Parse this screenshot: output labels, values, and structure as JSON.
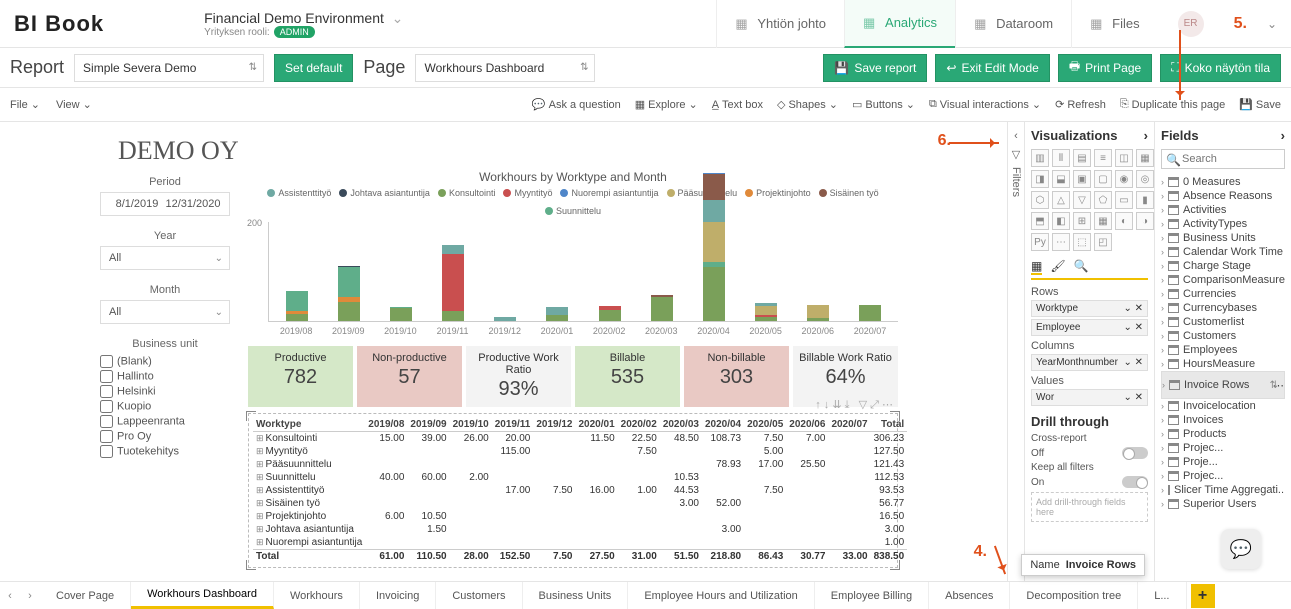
{
  "logo": "BI Book",
  "env": {
    "title": "Financial Demo Environment",
    "sub": "Yrityksen rooli:",
    "badge": "ADMIN"
  },
  "topnav": [
    {
      "label": "Yhtiön johto"
    },
    {
      "label": "Analytics",
      "active": true
    },
    {
      "label": "Dataroom"
    },
    {
      "label": "Files"
    }
  ],
  "user": "ER",
  "annot": {
    "n4": "4.",
    "n5": "5.",
    "n6": "6."
  },
  "bar2": {
    "report_lbl": "Report",
    "report_val": "Simple Severa Demo",
    "setdefault": "Set default",
    "page_lbl": "Page",
    "page_val": "Workhours Dashboard",
    "save": "Save report",
    "exit": "Exit Edit Mode",
    "print": "Print Page",
    "full": "Koko näytön tila"
  },
  "bar3": {
    "file": "File",
    "view": "View",
    "ask": "Ask a question",
    "explore": "Explore",
    "textbox": "Text box",
    "shapes": "Shapes",
    "buttons": "Buttons",
    "vis": "Visual interactions",
    "refresh": "Refresh",
    "dup": "Duplicate this page",
    "save": "Save"
  },
  "company": "DEMO OY",
  "slicers": {
    "period": {
      "hdr": "Period",
      "from": "8/1/2019",
      "to": "12/31/2020"
    },
    "year": {
      "hdr": "Year",
      "val": "All"
    },
    "month": {
      "hdr": "Month",
      "val": "All"
    },
    "bu": {
      "hdr": "Business unit",
      "items": [
        "(Blank)",
        "Hallinto",
        "Helsinki",
        "Kuopio",
        "Lappeenranta",
        "Pro Oy",
        "Tuotekehitys"
      ]
    }
  },
  "chart_data": {
    "type": "bar",
    "title": "Workhours by Worktype and Month",
    "legend": [
      {
        "name": "Assistenttityö",
        "color": "#6fa9a3"
      },
      {
        "name": "Johtava asiantuntija",
        "color": "#3a4a5a"
      },
      {
        "name": "Konsultointi",
        "color": "#7aa05a"
      },
      {
        "name": "Myyntityö",
        "color": "#c94f4f"
      },
      {
        "name": "Nuorempi asiantuntija",
        "color": "#4f86c9"
      },
      {
        "name": "Pääsuunnittelu",
        "color": "#bfae6a"
      },
      {
        "name": "Projektinjohto",
        "color": "#e08a3a"
      },
      {
        "name": "Sisäinen työ",
        "color": "#8a5a4a"
      },
      {
        "name": "Suunnittelu",
        "color": "#5fae8a"
      }
    ],
    "ylim": [
      0,
      200
    ],
    "yticks": [
      200
    ],
    "categories": [
      "2019/08",
      "2019/09",
      "2019/10",
      "2019/11",
      "2019/12",
      "2020/01",
      "2020/02",
      "2020/03",
      "2020/04",
      "2020/05",
      "2020/06",
      "2020/07"
    ],
    "stacks": [
      [
        {
          "c": "#7aa05a",
          "v": 15
        },
        {
          "c": "#e08a3a",
          "v": 6
        },
        {
          "c": "#5fae8a",
          "v": 40
        }
      ],
      [
        {
          "c": "#7aa05a",
          "v": 39
        },
        {
          "c": "#e08a3a",
          "v": 10
        },
        {
          "c": "#5fae8a",
          "v": 60
        },
        {
          "c": "#3a4a5a",
          "v": 1.5
        }
      ],
      [
        {
          "c": "#7aa05a",
          "v": 26
        },
        {
          "c": "#5fae8a",
          "v": 2
        }
      ],
      [
        {
          "c": "#7aa05a",
          "v": 20
        },
        {
          "c": "#c94f4f",
          "v": 115
        },
        {
          "c": "#6fa9a3",
          "v": 17
        }
      ],
      [
        {
          "c": "#6fa9a3",
          "v": 7.5
        }
      ],
      [
        {
          "c": "#7aa05a",
          "v": 11.5
        },
        {
          "c": "#6fa9a3",
          "v": 16
        }
      ],
      [
        {
          "c": "#7aa05a",
          "v": 22.5
        },
        {
          "c": "#c94f4f",
          "v": 7.5
        },
        {
          "c": "#6fa9a3",
          "v": 1
        }
      ],
      [
        {
          "c": "#7aa05a",
          "v": 48.5
        },
        {
          "c": "#8a5a4a",
          "v": 3
        }
      ],
      [
        {
          "c": "#7aa05a",
          "v": 108
        },
        {
          "c": "#5fae8a",
          "v": 10.5
        },
        {
          "c": "#bfae6a",
          "v": 78.9
        },
        {
          "c": "#6fa9a3",
          "v": 44.5
        },
        {
          "c": "#8a5a4a",
          "v": 52
        },
        {
          "c": "#4f86c9",
          "v": 3
        }
      ],
      [
        {
          "c": "#7aa05a",
          "v": 7.5
        },
        {
          "c": "#c94f4f",
          "v": 5
        },
        {
          "c": "#bfae6a",
          "v": 17
        },
        {
          "c": "#6fa9a3",
          "v": 7.5
        }
      ],
      [
        {
          "c": "#7aa05a",
          "v": 7
        },
        {
          "c": "#bfae6a",
          "v": 25.5
        }
      ],
      [
        {
          "c": "#7aa05a",
          "v": 33
        }
      ]
    ]
  },
  "kpis": [
    {
      "label": "Productive",
      "value": "782",
      "cls": "green"
    },
    {
      "label": "Non-productive",
      "value": "57",
      "cls": "red"
    },
    {
      "label": "Productive Work Ratio",
      "value": "93%",
      "cls": "gray"
    },
    {
      "label": "Billable",
      "value": "535",
      "cls": "green"
    },
    {
      "label": "Non-billable",
      "value": "303",
      "cls": "red"
    },
    {
      "label": "Billable Work Ratio",
      "value": "64%",
      "cls": "gray"
    }
  ],
  "matrix": {
    "header": [
      "Worktype",
      "2019/08",
      "2019/09",
      "2019/10",
      "2019/11",
      "2019/12",
      "2020/01",
      "2020/02",
      "2020/03",
      "2020/04",
      "2020/05",
      "2020/06",
      "2020/07",
      "Total"
    ],
    "rows": [
      [
        "Konsultointi",
        "15.00",
        "39.00",
        "26.00",
        "20.00",
        "",
        "11.50",
        "22.50",
        "48.50",
        "108.73",
        "7.50",
        "7.00",
        "",
        "306.23"
      ],
      [
        "Myyntityö",
        "",
        "",
        "",
        "115.00",
        "",
        "",
        "7.50",
        "",
        "",
        "5.00",
        "",
        "",
        "127.50"
      ],
      [
        "Pääsuunnittelu",
        "",
        "",
        "",
        "",
        "",
        "",
        "",
        "",
        "78.93",
        "17.00",
        "25.50",
        "",
        "121.43"
      ],
      [
        "Suunnittelu",
        "40.00",
        "60.00",
        "2.00",
        "",
        "",
        "",
        "",
        "10.53",
        "",
        "",
        "",
        "",
        "112.53"
      ],
      [
        "Assistenttityö",
        "",
        "",
        "",
        "17.00",
        "7.50",
        "16.00",
        "1.00",
        "44.53",
        "",
        "7.50",
        "",
        "",
        "93.53"
      ],
      [
        "Sisäinen työ",
        "",
        "",
        "",
        "",
        "",
        "",
        "",
        "3.00",
        "52.00",
        "",
        "",
        "",
        "56.77"
      ],
      [
        "Projektinjohto",
        "6.00",
        "10.50",
        "",
        "",
        "",
        "",
        "",
        "",
        "",
        "",
        "",
        "",
        "16.50"
      ],
      [
        "Johtava asiantuntija",
        "",
        "1.50",
        "",
        "",
        "",
        "",
        "",
        "",
        "3.00",
        "",
        "",
        "",
        "3.00"
      ],
      [
        "Nuorempi asiantuntija",
        "",
        "",
        "",
        "",
        "",
        "",
        "",
        "",
        "",
        "",
        "",
        "",
        "1.00"
      ]
    ],
    "total": [
      "Total",
      "61.00",
      "110.50",
      "28.00",
      "152.50",
      "7.50",
      "27.50",
      "31.00",
      "51.50",
      "218.80",
      "86.43",
      "30.77",
      "33.00",
      "838.50"
    ]
  },
  "filters_label": "Filters",
  "viz": {
    "hdr": "Visualizations",
    "rows_lbl": "Rows",
    "rows": [
      "Worktype",
      "Employee"
    ],
    "cols_lbl": "Columns",
    "cols": [
      "YearMonthnumber"
    ],
    "values_lbl": "Values",
    "values_trunc": "Wor",
    "tooltip": {
      "name_lbl": "Name",
      "val": "Invoice Rows"
    },
    "drill": "Drill through",
    "cross": "Cross-report",
    "off": "Off",
    "keep": "Keep all filters",
    "on": "On",
    "placeholder": "Add drill-through fields here"
  },
  "fields": {
    "hdr": "Fields",
    "search": "Search",
    "list": [
      "0 Measures",
      "Absence Reasons",
      "Activities",
      "ActivityTypes",
      "Business Units",
      "Calendar Work Time",
      "Charge Stage",
      "ComparisonMeasure",
      "Currencies",
      "Currencybases",
      "Customerlist",
      "Customers",
      "Employees",
      "HoursMeasure",
      "Invoice Rows",
      "Invoicelocation",
      "Invoices",
      "Products",
      "Projec...",
      "Proje...",
      "Projec...",
      "Slicer Time Aggregati...",
      "Superior Users"
    ],
    "selected": "Invoice Rows"
  },
  "tabs": [
    "Cover Page",
    "Workhours Dashboard",
    "Workhours",
    "Invoicing",
    "Customers",
    "Business Units",
    "Employee Hours and Utilization",
    "Employee Billing",
    "Absences",
    "Decomposition tree",
    "L..."
  ],
  "active_tab": "Workhours Dashboard"
}
